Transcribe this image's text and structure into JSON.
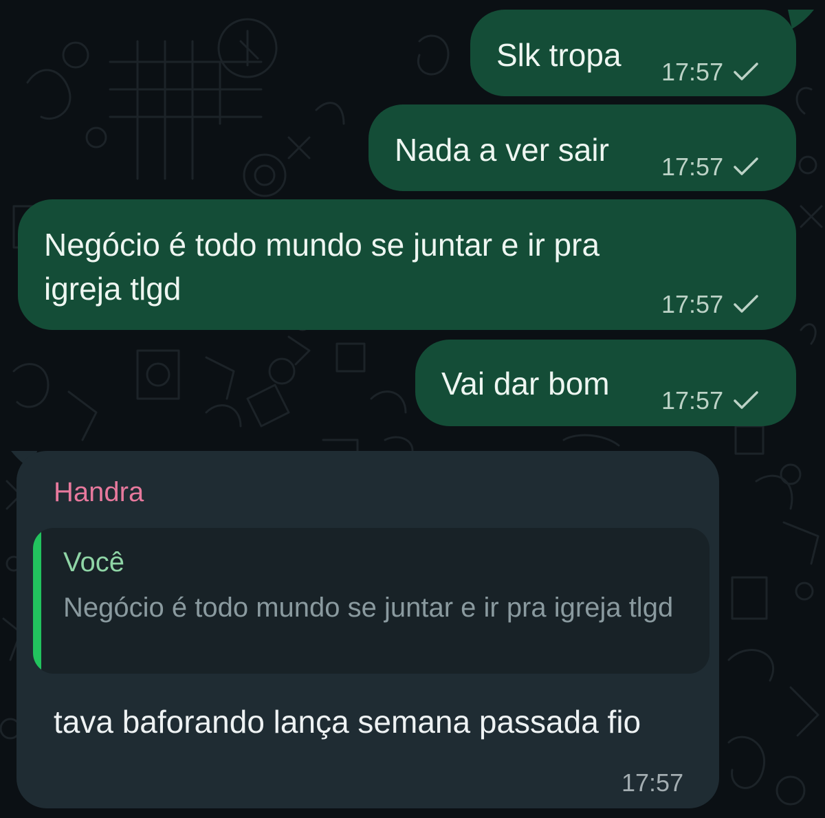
{
  "theme": {
    "outgoing_bubble": "#144d37",
    "incoming_bubble": "#1f2c33",
    "quote_accent": "#22c35e",
    "sender_color": "#e7799d",
    "background": "#0b1014"
  },
  "messages": [
    {
      "direction": "outgoing",
      "lines": [
        "Slk tropa"
      ],
      "time": "17:57",
      "status": "sent-single-check-icon"
    },
    {
      "direction": "outgoing",
      "lines": [
        "Nada a ver sair"
      ],
      "time": "17:57",
      "status": "sent-single-check-icon"
    },
    {
      "direction": "outgoing",
      "lines": [
        "Negócio é todo mundo se juntar e ir pra",
        "igreja tlgd"
      ],
      "time": "17:57",
      "status": "sent-single-check-icon"
    },
    {
      "direction": "outgoing",
      "lines": [
        "Vai dar bom"
      ],
      "time": "17:57",
      "status": "sent-single-check-icon"
    },
    {
      "direction": "incoming",
      "sender": "Handra",
      "quote": {
        "author": "Você",
        "text": "Negócio é todo mundo se juntar e ir pra igreja tlgd"
      },
      "text": "tava baforando lança semana passada fio",
      "time": "17:57"
    }
  ]
}
